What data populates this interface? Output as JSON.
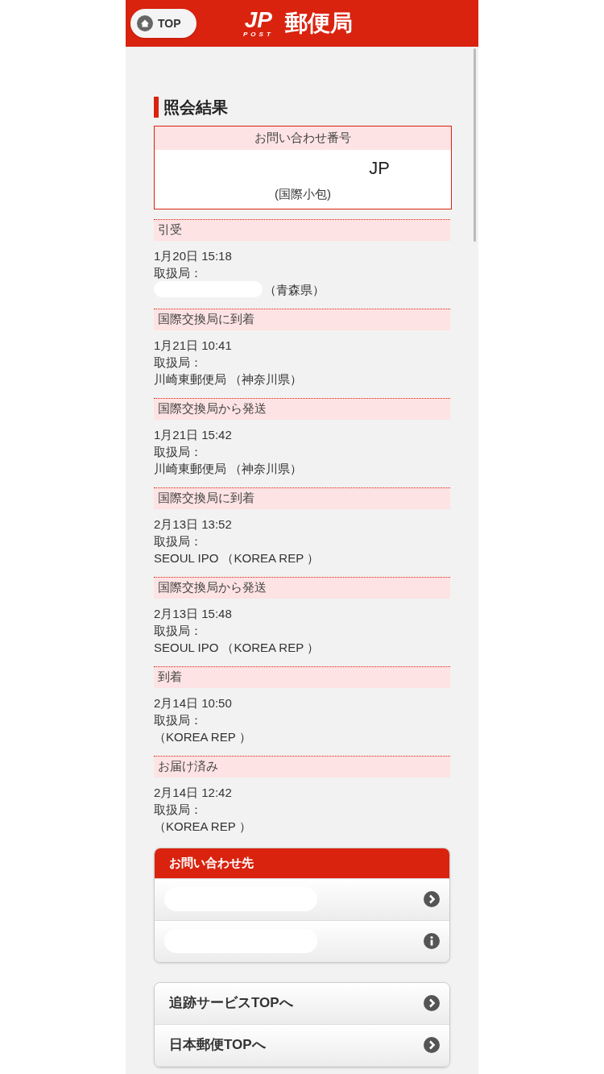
{
  "header": {
    "top_button": "TOP",
    "logo_mark": "JP",
    "logo_sub": "POST",
    "logo_text": "郵便局"
  },
  "title": "照会結果",
  "inquiry": {
    "label": "お問い合わせ番号",
    "number": "JP",
    "type": "(国際小包)"
  },
  "events": [
    {
      "status": "引受",
      "datetime": "1月20日 15:18",
      "office_label": "取扱局：",
      "office": "（青森県）",
      "redacted": true
    },
    {
      "status": "国際交換局に到着",
      "datetime": "1月21日 10:41",
      "office_label": "取扱局：",
      "office": "川崎東郵便局 （神奈川県）",
      "redacted": false
    },
    {
      "status": "国際交換局から発送",
      "datetime": "1月21日 15:42",
      "office_label": "取扱局：",
      "office": "川崎東郵便局 （神奈川県）",
      "redacted": false
    },
    {
      "status": "国際交換局に到着",
      "datetime": "2月13日 13:52",
      "office_label": "取扱局：",
      "office": "SEOUL IPO （KOREA REP ）",
      "redacted": false
    },
    {
      "status": "国際交換局から発送",
      "datetime": "2月13日 15:48",
      "office_label": "取扱局：",
      "office": "SEOUL IPO （KOREA REP ）",
      "redacted": false
    },
    {
      "status": "到着",
      "datetime": "2月14日 10:50",
      "office_label": "取扱局：",
      "office": "（KOREA REP ）",
      "redacted": false
    },
    {
      "status": "お届け済み",
      "datetime": "2月14日 12:42",
      "office_label": "取扱局：",
      "office": "（KOREA REP ）",
      "redacted": false
    }
  ],
  "contact": {
    "title": "お問い合わせ先",
    "rows": [
      {
        "kind": "link"
      },
      {
        "kind": "info"
      }
    ]
  },
  "nav": [
    {
      "label": "追跡サービスTOPへ"
    },
    {
      "label": "日本郵便TOPへ"
    }
  ]
}
